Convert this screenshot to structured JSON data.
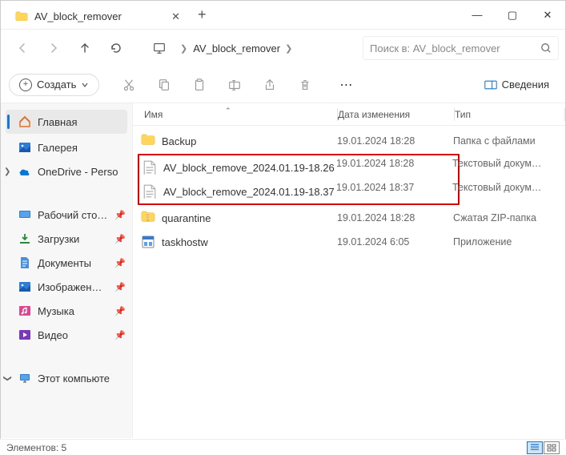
{
  "window": {
    "tab_title": "AV_block_remover"
  },
  "nav": {
    "breadcrumb": "AV_block_remover",
    "search_placeholder": "Поиск в: AV_block_remover"
  },
  "toolbar": {
    "create_label": "Создать",
    "details_label": "Сведения"
  },
  "sidebar": {
    "home": "Главная",
    "gallery": "Галерея",
    "onedrive": "OneDrive - Perso",
    "desktop": "Рабочий сто…",
    "downloads": "Загрузки",
    "documents": "Документы",
    "pictures": "Изображен…",
    "music": "Музыка",
    "videos": "Видео",
    "this_pc": "Этот компьюте"
  },
  "columns": {
    "name": "Имя",
    "date": "Дата изменения",
    "type": "Тип"
  },
  "files": [
    {
      "name": "Backup",
      "date": "19.01.2024 18:28",
      "type": "Папка с файлами",
      "icon": "folder"
    },
    {
      "name": "AV_block_remove_2024.01.19-18.26",
      "date": "19.01.2024 18:28",
      "type": "Текстовый докум…",
      "icon": "text",
      "hl": true
    },
    {
      "name": "AV_block_remove_2024.01.19-18.37",
      "date": "19.01.2024 18:37",
      "type": "Текстовый докум…",
      "icon": "text",
      "hl": true
    },
    {
      "name": "quarantine",
      "date": "19.01.2024 18:28",
      "type": "Сжатая ZIP-папка",
      "icon": "zip"
    },
    {
      "name": "taskhostw",
      "date": "19.01.2024 6:05",
      "type": "Приложение",
      "icon": "exe"
    }
  ],
  "status": {
    "elements": "Элементов: 5"
  }
}
